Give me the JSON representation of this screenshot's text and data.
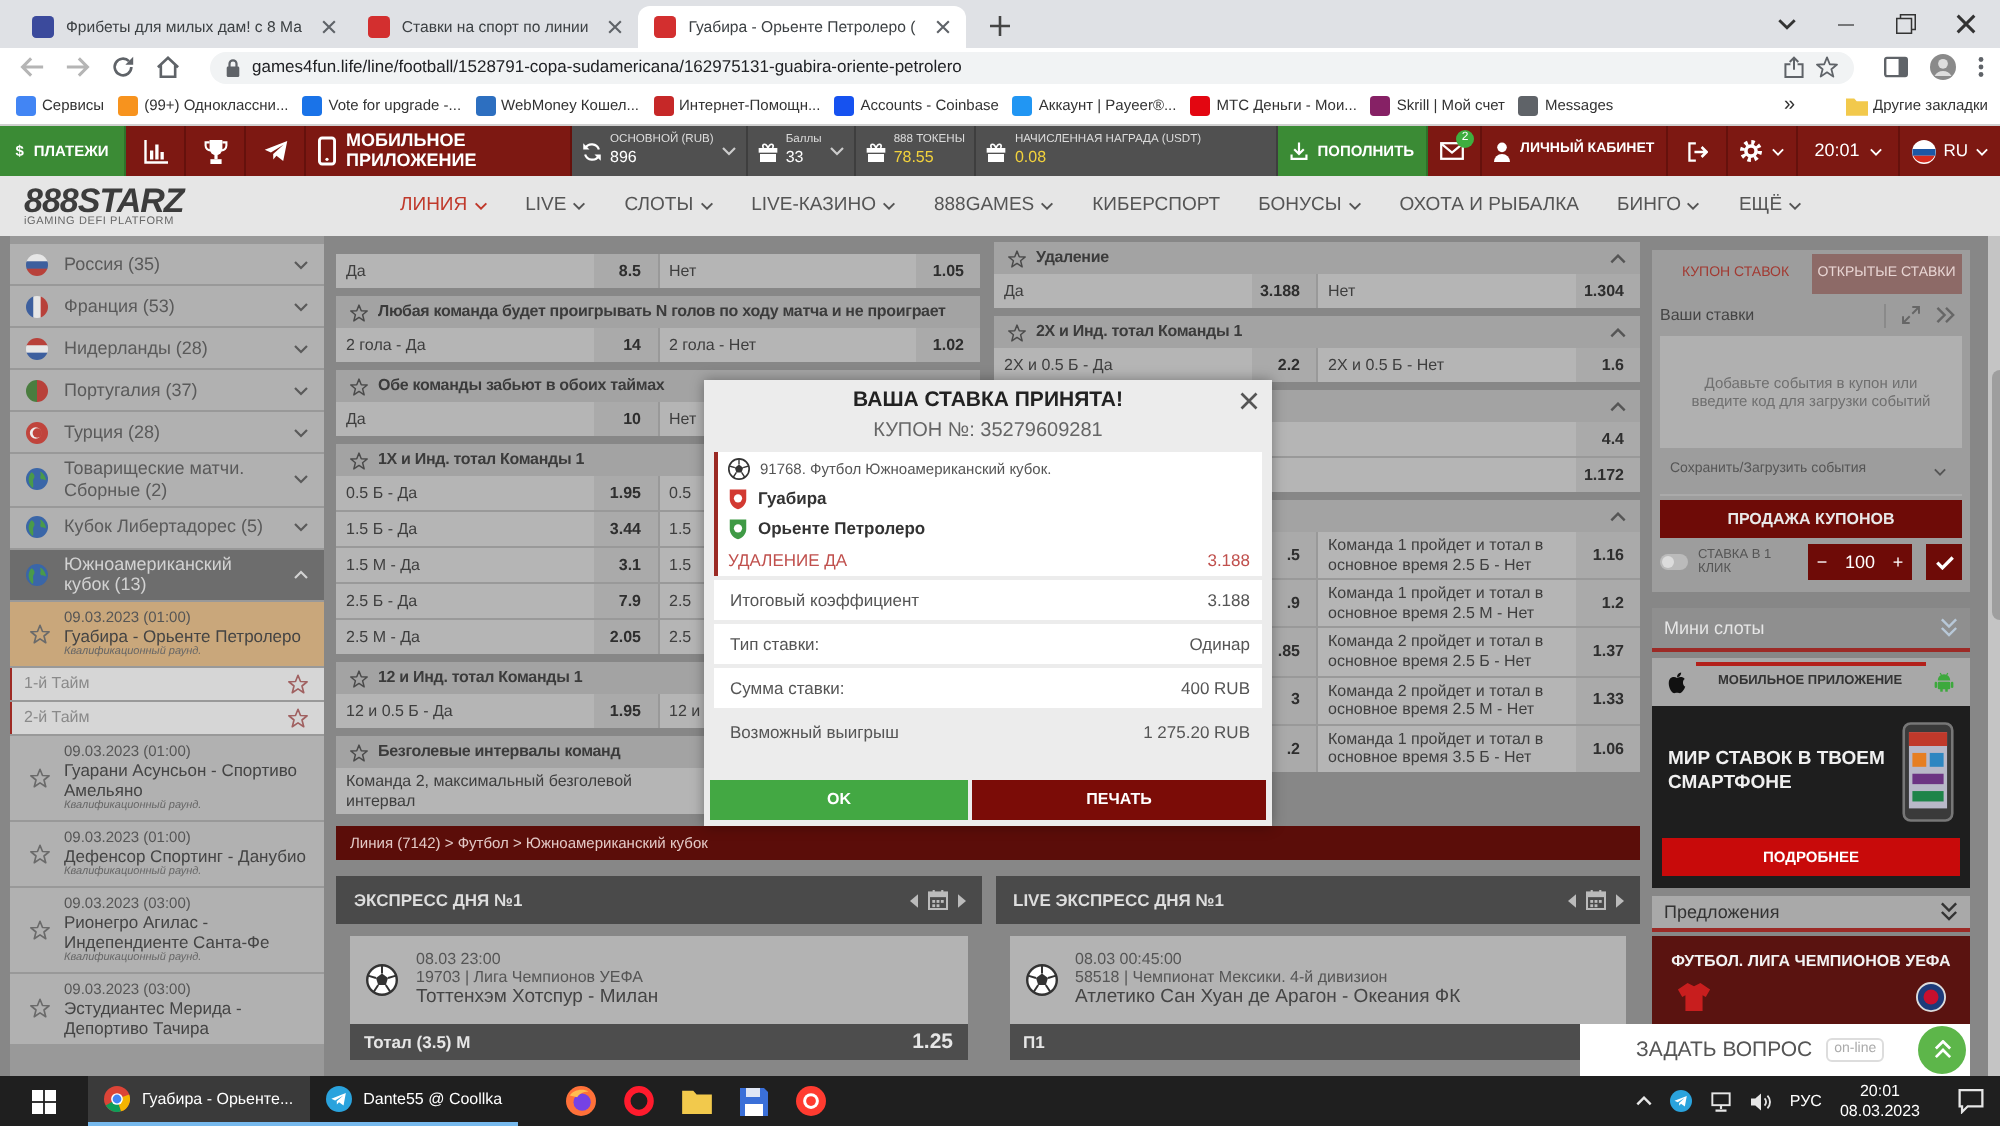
{
  "browser": {
    "tabs": [
      {
        "title": "Фрибеты для милых дам! с 8 Ма",
        "color": "#3b4a9c",
        "selected": false
      },
      {
        "title": "Ставки на спорт по линии",
        "color": "#d32f2f",
        "selected": false
      },
      {
        "title": "Гуабира - Орьенте Петролеро (",
        "color": "#d32f2f",
        "selected": true
      }
    ],
    "url": "games4fun.life/line/football/1528791-copa-sudamericana/162975131-guabira-oriente-petrolero",
    "bookmarks": [
      {
        "label": "Сервисы",
        "color": "#4285f4"
      },
      {
        "label": "(99+) Одноклассни...",
        "color": "#f7931e"
      },
      {
        "label": "Vote for upgrade -...",
        "color": "#1a73e8"
      },
      {
        "label": "WebMoney Кошел...",
        "color": "#2d6fc0"
      },
      {
        "label": "Интернет-Помощн...",
        "color": "#c62828"
      },
      {
        "label": "Accounts - Coinbase",
        "color": "#1652f0"
      },
      {
        "label": "Аккаунт | Payeer®...",
        "color": "#2196f3"
      },
      {
        "label": "МТС Деньги - Мои...",
        "color": "#e30611"
      },
      {
        "label": "Skrill | Мой счет",
        "color": "#862165"
      },
      {
        "label": "Messages",
        "color": "#5f6368"
      }
    ],
    "more_bookmarks": "»",
    "other_bookmarks": "Другие закладки"
  },
  "site_header": {
    "payments_icon": "$",
    "payments": "ПЛАТЕЖИ",
    "mobile_app": "МОБИЛЬНОЕ ПРИЛОЖЕНИЕ",
    "balances": [
      {
        "kind": "wallet",
        "label": "ОСНОВНОЙ (RUB)",
        "value": "896"
      },
      {
        "kind": "points",
        "label": "Баллы",
        "value": "33"
      },
      {
        "kind": "token",
        "label": "888 ТОКЕНЫ",
        "value": "78.55"
      },
      {
        "kind": "token",
        "label": "НАЧИСЛЕННАЯ НАГРАДА (USDT)",
        "value": "0.08"
      }
    ],
    "deposit": "ПОПОЛНИТЬ",
    "mail_count": "2",
    "account": "ЛИЧНЫЙ КАБИНЕТ",
    "time": "20:01",
    "language": "RU"
  },
  "nav": {
    "logo": "888STARZ",
    "tagline": "iGAMING DEFI PLATFORM",
    "items": [
      {
        "label": "ЛИНИЯ",
        "dropdown": true,
        "selected": true
      },
      {
        "label": "LIVE",
        "dropdown": true,
        "selected": false
      },
      {
        "label": "СЛОТЫ",
        "dropdown": true,
        "selected": false
      },
      {
        "label": "LIVE-КАЗИНО",
        "dropdown": true,
        "selected": false
      },
      {
        "label": "888GAMES",
        "dropdown": true,
        "selected": false
      },
      {
        "label": "КИБЕРСПОРТ",
        "dropdown": false,
        "selected": false
      },
      {
        "label": "БОНУСЫ",
        "dropdown": true,
        "selected": false
      },
      {
        "label": "ОХОТА И РЫБАЛКА",
        "dropdown": false,
        "selected": false
      },
      {
        "label": "БИНГО",
        "dropdown": true,
        "selected": false
      },
      {
        "label": "ЕЩЁ",
        "dropdown": true,
        "selected": false
      }
    ]
  },
  "sidebar": {
    "leagues": [
      {
        "name": "Россия (35)",
        "kind": "flag",
        "expanded": false
      },
      {
        "name": "Франция (53)",
        "kind": "flag",
        "expanded": false
      },
      {
        "name": "Нидерланды (28)",
        "kind": "flag",
        "expanded": false
      },
      {
        "name": "Португалия (37)",
        "kind": "flag",
        "expanded": false
      },
      {
        "name": "Турция (28)",
        "kind": "flag",
        "expanded": false
      },
      {
        "name": "Товарищеские матчи. Сборные (2)",
        "kind": "globe",
        "expanded": false
      },
      {
        "name": "Кубок Либертадорес (5)",
        "kind": "globe",
        "expanded": false
      },
      {
        "name": "Южноамериканский кубок (13)",
        "kind": "globe",
        "expanded": true,
        "matches": [
          {
            "date": "09.03.2023 (01:00)",
            "teams": "Гуабира - Орьенте Петролеро",
            "round": "Квалификационный раунд.",
            "selected": true,
            "periods": [
              "1-й Тайм",
              "2-й Тайм"
            ]
          },
          {
            "date": "09.03.2023 (01:00)",
            "teams": "Гуарани Асунсьон - Спортиво Амельяно",
            "round": "Квалификационный раунд.",
            "selected": false
          },
          {
            "date": "09.03.2023 (01:00)",
            "teams": "Дефенсор Спортинг - Данубио",
            "round": "Квалификационный раунд.",
            "selected": false
          },
          {
            "date": "09.03.2023 (03:00)",
            "teams": "Рионегро Агилас - Индепендиенте Санта-Фе",
            "round": "Квалификационный раунд.",
            "selected": false
          },
          {
            "date": "09.03.2023 (03:00)",
            "teams": "Эстудиантес Мерида - Депортиво Тачира",
            "selected": false
          }
        ]
      }
    ]
  },
  "markets": {
    "columns": [
      [
        {
          "rows": [
            [
              {
                "label": "Да",
                "odds": "8.5"
              },
              {
                "label": "Нет",
                "odds": "1.05"
              }
            ]
          ]
        },
        {
          "title": "Любая команда будет проигрывать N голов по ходу матча и не проиграет",
          "rows": [
            [
              {
                "label": "2 гола - Да",
                "odds": "14"
              },
              {
                "label": "2 гола - Нет",
                "odds": "1.02"
              }
            ]
          ]
        },
        {
          "title": "Обе команды забьют в обоих таймах",
          "rows": [
            [
              {
                "label": "Да",
                "odds": "10"
              },
              {
                "label": "Нет"
              }
            ]
          ]
        },
        {
          "title": "1X и Инд. тотал Команды 1",
          "rows": [
            [
              {
                "label": "0.5 Б - Да",
                "odds": "1.95"
              },
              {
                "label": "0.5"
              }
            ],
            [
              {
                "label": "1.5 Б - Да",
                "odds": "3.44"
              },
              {
                "label": "1.5"
              }
            ],
            [
              {
                "label": "1.5 М - Да",
                "odds": "3.1"
              },
              {
                "label": "1.5"
              }
            ],
            [
              {
                "label": "2.5 Б - Да",
                "odds": "7.9"
              },
              {
                "label": "2.5"
              }
            ],
            [
              {
                "label": "2.5 М - Да",
                "odds": "2.05"
              },
              {
                "label": "2.5"
              }
            ]
          ]
        },
        {
          "title": "12 и Инд. тотал Команды 1",
          "rows": [
            [
              {
                "label": "12 и 0.5 Б - Да",
                "odds": "1.95"
              },
              {
                "label": "12 и"
              }
            ]
          ]
        },
        {
          "title": "Безголевые интервалы команд",
          "rows": [
            [
              {
                "label": "Команда 2, максимальный безголевой интервал"
              }
            ]
          ]
        }
      ],
      [
        {
          "title": "Удаление",
          "expanded": true,
          "rows": [
            [
              {
                "label": "Да",
                "odds": "3.188"
              },
              {
                "label": "Нет",
                "odds": "1.304"
              }
            ]
          ]
        },
        {
          "title": "2X и Инд. тотал Команды 1",
          "expanded": true,
          "rows": [
            [
              {
                "label": "2X и 0.5 Б - Да",
                "odds": "2.2"
              },
              {
                "label": "2X и 0.5 Б - Нет",
                "odds": "1.6"
              }
            ]
          ]
        },
        {
          "expanded": true,
          "rows": [
            [
              {
                "odds": "4.4"
              }
            ],
            [
              {
                "odds": "1.172"
              }
            ]
          ]
        },
        {
          "expanded": true,
          "rows": [
            [
              {
                "odds": ".5"
              },
              {
                "label": "Команда 1 пройдет и тотал в основное время 2.5 Б - Нет",
                "odds": "1.16"
              }
            ],
            [
              {
                "odds": ".9"
              },
              {
                "label": "Команда 1 пройдет и тотал в основное время 2.5 М - Нет",
                "odds": "1.2"
              }
            ],
            [
              {
                "odds": ".85"
              },
              {
                "label": "Команда 2 пройдет и тотал в основное время 2.5 Б - Нет",
                "odds": "1.37"
              }
            ],
            [
              {
                "odds": "3"
              },
              {
                "label": "Команда 2 пройдет и тотал в основное время 2.5 М - Нет",
                "odds": "1.33"
              }
            ],
            [
              {
                "odds": ".2"
              },
              {
                "label": "Команда 1 пройдет и тотал в основное время 3.5 Б - Нет",
                "odds": "1.06"
              }
            ]
          ]
        }
      ]
    ]
  },
  "breadcrumb": "Линия (7142) > Футбол > Южноамериканский кубок",
  "express": [
    {
      "title": "ЭКСПРЕСС ДНЯ №1",
      "date": "08.03  23:00",
      "event": "19703 | Лига Чемпионов УЕФА",
      "teams": "Тоттенхэм Хотспур - Милан",
      "bet": "Тотал (3.5) М",
      "odds": "1.25"
    },
    {
      "title": "LIVE ЭКСПРЕСС ДНЯ №1",
      "date": "08.03  00:45:00",
      "event": "58518 | Чемпионат Мексики. 4-й дивизион",
      "teams": "Атлетико Сан Хуан де Арагон - Океания ФК",
      "bet": "П1"
    }
  ],
  "coupon": {
    "tabs": [
      {
        "label": "КУПОН СТАВОК",
        "selected": true
      },
      {
        "label": "ОТКРЫТЫЕ СТАВКИ",
        "selected": false
      }
    ],
    "heading": "Ваши ставки",
    "empty_text": "Добавьте события в купон или введите код для загрузки событий",
    "save_load": "Сохранить/Загрузить события",
    "sell_button": "ПРОДАЖА КУПОНОВ",
    "one_click": {
      "label": "СТАВКА В 1 КЛИК",
      "on": false
    },
    "stake": {
      "minus": "−",
      "value": "100",
      "plus": "+"
    }
  },
  "mini_slots": {
    "title": "Мини слоты"
  },
  "app_banner": {
    "title": "МОБИЛЬНОЕ ПРИЛОЖЕНИЕ",
    "slogan": "МИР СТАВОК В ТВОЕМ СМАРТФОНЕ",
    "button": "ПОДРОБНЕЕ"
  },
  "offers": {
    "title": "Предложения",
    "banner": "ФУТБОЛ. ЛИГА ЧЕМПИОНОВ УЕФА"
  },
  "chat": {
    "label": "ЗАДАТЬ ВОПРОС",
    "status": "on-line"
  },
  "bet_modal": {
    "title": "ВАША СТАВКА ПРИНЯТА!",
    "coupon": "КУПОН №: 35279609281",
    "event": "91768. Футбол Южноамериканский кубок.",
    "teams": [
      {
        "name": "Гуабира",
        "color": "#d23a32"
      },
      {
        "name": "Орьенте Петролеро",
        "color": "#3f9a45"
      }
    ],
    "pick": "УДАЛЕНИЕ ДА",
    "pick_odds": "3.188",
    "details": [
      {
        "kind": "row",
        "label": "Итоговый коэффициент",
        "value": "3.188"
      },
      {
        "kind": "row",
        "label": "Тип ставки:",
        "value": "Одинар"
      },
      {
        "kind": "row",
        "label": "Сумма ставки:",
        "value": "400 RUB"
      },
      {
        "kind": "total",
        "label": "Возможный выигрыш",
        "value": "1 275.20 RUB"
      }
    ],
    "buttons": [
      {
        "kind": "confirm",
        "label": "OK"
      },
      {
        "kind": "print",
        "label": "ПЕЧАТЬ"
      }
    ]
  },
  "taskbar": {
    "windows": [
      {
        "kind": "browser",
        "label": "Гуабира - Орьенте...",
        "selected": true
      },
      {
        "kind": "messenger",
        "label": "Dante55 @ Coollka",
        "selected": false
      }
    ],
    "language": "РУС",
    "time": "20:01",
    "date": "08.03.2023"
  }
}
